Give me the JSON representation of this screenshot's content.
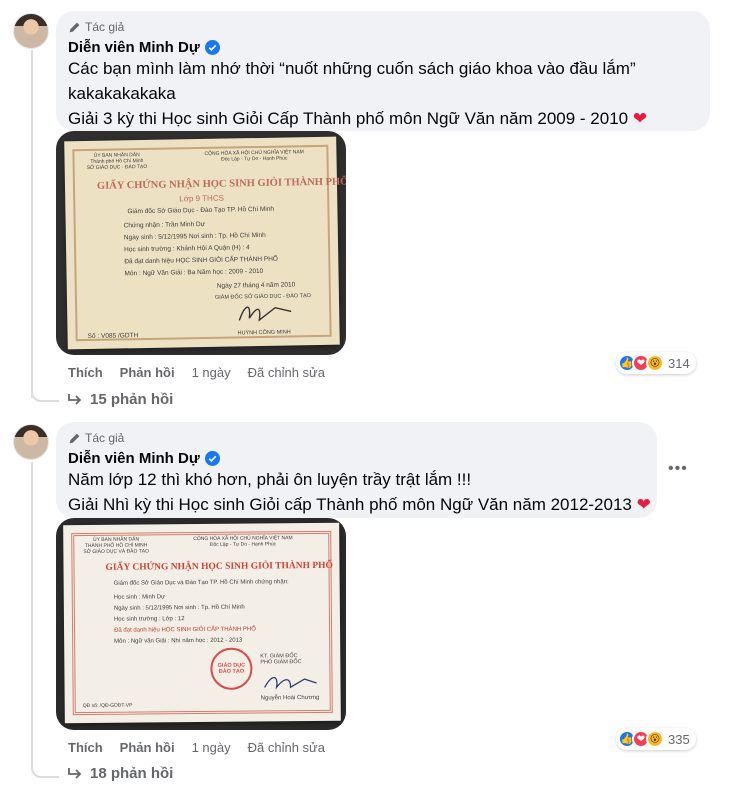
{
  "comments": [
    {
      "author_tag": "Tác giả",
      "author_name": "Diễn viên Minh Dự",
      "lines": [
        "Các bạn mình làm nhớ thời “nuốt những cuốn sách giáo khoa vào đầu lắm”",
        "kakakakakaka",
        "Giải 3 kỳ thi Học sinh Giỏi Cấp Thành phố môn Ngữ Văn năm 2009 - 2010"
      ],
      "photo": {
        "header_left": "ỦY BAN NHÂN DÂN\nThành phố Hồ Chí Minh\nSỞ GIÁO DỤC - ĐÀO TẠO",
        "header_right": "CỘNG HÒA XÃ HỘI CHỦ NGHĨA VIỆT NAM\nĐộc Lập - Tự Do - Hạnh Phúc",
        "title": "GIẤY CHỨNG NHẬN HỌC SINH GIỎI THÀNH PHỐ",
        "subtitle": "Lớp 9 THCS",
        "issuer": "Giám đốc Sở Giáo Dục - Đào Tạo TP. Hồ Chí Minh",
        "name_line": "Chứng nhận :   Trần Minh Dự",
        "dob_line": "Ngày sinh :   5/12/1995      Nơi sinh :  Tp. Hồ Chí Minh",
        "school_line": "Học sinh trường :   Khánh Hội A          Quận (H) :  4",
        "award_line": "Đã đạt danh hiệu   HỌC SINH GIỎI CẤP THÀNH PHỐ",
        "subject_line": "Môn :   Ngữ Văn        Giải :  Ba         Năm học : 2009 - 2010",
        "date_line": "Ngày  27  tháng  4  năm  2010",
        "signer_title": "GIÁM ĐỐC SỞ GIÁO DỤC - ĐÀO TẠO",
        "signer_name": "HUỲNH CÔNG MINH",
        "serial": "Số : V085 /GDTH"
      },
      "actions": {
        "like": "Thích",
        "reply": "Phản hồi",
        "time": "1 ngày",
        "edited": "Đã chỉnh sửa"
      },
      "reaction_count": "314",
      "replies": "15 phản hồi"
    },
    {
      "author_tag": "Tác giả",
      "author_name": "Diễn viên Minh Dự",
      "lines": [
        "Năm lớp 12 thì khó hơn, phải ôn luyện trầy trật lắm !!!",
        "Giải Nhì kỳ thi Học sinh Giỏi cấp Thành phố môn Ngữ Văn năm 2012-2013"
      ],
      "photo": {
        "header_left": "ỦY BAN NHÂN DÂN\nTHÀNH PHỐ HỒ CHÍ MINH\nSỞ GIÁO DỤC VÀ ĐÀO TẠO",
        "header_right": "CỘNG HÒA XÃ HỘI CHỦ NGHĨA VIỆT NAM\nĐộc Lập - Tự Do - Hạnh Phúc",
        "title": "GIẤY CHỨNG NHẬN HỌC SINH GIỎI THÀNH PHỐ",
        "issuer": "Giám đốc Sở Giáo Dục và Đào Tạo TP. Hồ Chí Minh chứng nhận:",
        "name_line": "Học sinh :          Minh Dự",
        "dob_line": "Ngày sinh :  5/12/1995     Nơi sinh :  Tp. Hồ Chí Minh",
        "school_line": "Học sinh trường :                      Lớp :  12",
        "award_line": "Đã đạt danh hiệu  HỌC SINH GIỎI CẤP THÀNH PHỐ",
        "subject_line": "Môn :   Ngữ văn         Giải :  Nhì      năm học :  2012 - 2013",
        "stamp_text": "GIÁO DỤC\nĐÀO TẠO",
        "signer_title": "KT. GIÁM ĐỐC\nPHÓ GIÁM ĐỐC",
        "signer_name": "Nguyễn Hoài Chương",
        "serial": "QĐ số: /QĐ-GDĐT-VP"
      },
      "actions": {
        "like": "Thích",
        "reply": "Phản hồi",
        "time": "1 ngày",
        "edited": "Đã chỉnh sửa"
      },
      "reaction_count": "335",
      "replies": "18 phản hồi"
    }
  ],
  "colors": {
    "bubble": "#f0f2f5",
    "verified": "#1877f2",
    "heart": "#e41e3f",
    "meta": "#65676b"
  },
  "icons": {
    "pen": "pen-icon",
    "verified": "verified-badge-icon",
    "reply_arrow": "reply-arrow-icon",
    "more": "more-options-icon"
  }
}
